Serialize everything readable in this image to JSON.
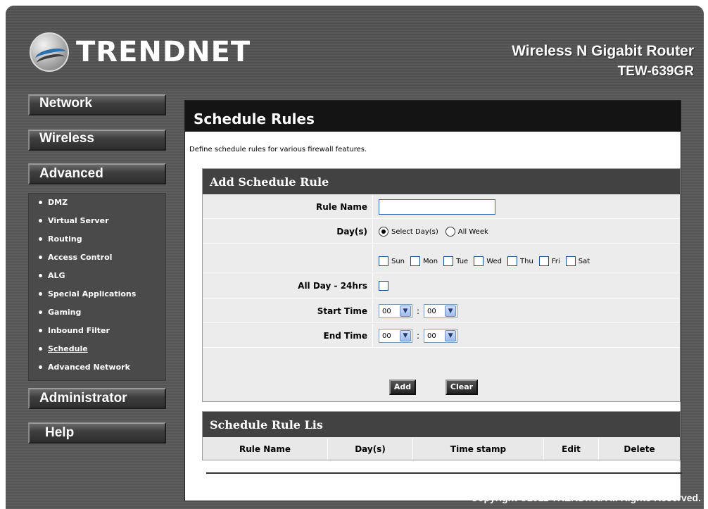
{
  "brand": {
    "logo_text": "TRENDNET",
    "product_name": "Wireless N Gigabit Router",
    "model": "TEW-639GR"
  },
  "nav": {
    "network": "Network",
    "wireless": "Wireless",
    "advanced": "Advanced",
    "administrator": "Administrator",
    "help": "Help",
    "advanced_items": [
      {
        "label": "DMZ"
      },
      {
        "label": "Virtual Server"
      },
      {
        "label": "Routing"
      },
      {
        "label": "Access Control"
      },
      {
        "label": "ALG"
      },
      {
        "label": "Special Applications"
      },
      {
        "label": "Gaming"
      },
      {
        "label": "Inbound Filter"
      },
      {
        "label": "Schedule",
        "active": true
      },
      {
        "label": "Advanced Network"
      }
    ]
  },
  "page": {
    "title": "Schedule Rules",
    "description": "Define schedule rules for various firewall features."
  },
  "add_rule": {
    "heading": "Add Schedule Rule",
    "rule_name_label": "Rule Name",
    "rule_name_value": "",
    "days_label": "Day(s)",
    "days_options": [
      "Select Day(s)",
      "All Week"
    ],
    "days_selected": "Select Day(s)",
    "weekdays": [
      "Sun",
      "Mon",
      "Tue",
      "Wed",
      "Thu",
      "Fri",
      "Sat"
    ],
    "all_day_label": "All Day - 24hrs",
    "start_time_label": "Start Time",
    "end_time_label": "End Time",
    "start_hour": "00",
    "start_minute": "00",
    "end_hour": "00",
    "end_minute": "00",
    "colon": ":",
    "add_button": "Add",
    "clear_button": "Clear"
  },
  "rule_list": {
    "heading": "Schedule Rule Lis",
    "columns": [
      "Rule Name",
      "Day(s)",
      "Time stamp",
      "Edit",
      "Delete"
    ]
  },
  "footer": {
    "copyright": "Copyright ©2011 TRENDnet. All Rights Reserved."
  },
  "colors": {
    "title_bar": "#141414",
    "box_header": "#424242",
    "frame": "#555555"
  }
}
